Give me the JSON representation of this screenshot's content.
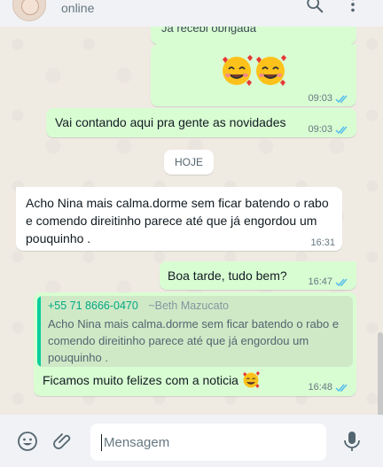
{
  "header": {
    "status": "online"
  },
  "messages": {
    "m1_text": "Já recebi obrigada",
    "m2_time": "09:03",
    "m3_text": "Vai contando aqui pra gente as novidades",
    "m3_time": "09:03",
    "date_divider": "HOJE",
    "m4_line1": "Acho Nina mais calma.dorme sem ficar batendo o rabo",
    "m4_line2": "e comendo direitinho parece até que já engordou um",
    "m4_line3": "pouquinho .",
    "m4_time": "16:31",
    "m5_text": "Boa tarde, tudo bem?",
    "m5_time": "16:47",
    "m6_quote_phone": "+55 71 8666-0470",
    "m6_quote_name": "~Beth Mazucato",
    "m6_quote_line1": "Acho Nina mais calma.dorme sem ficar batendo o rabo e",
    "m6_quote_line2": "comendo direitinho parece até que já engordou um",
    "m6_quote_line3": "pouquinho .",
    "m6_text": "Ficamos muito felizes com a noticia",
    "m6_time": "16:48"
  },
  "composer": {
    "placeholder": "Mensagem"
  },
  "icons": {
    "search": "search-icon",
    "menu": "more-vertical-icon",
    "emoji": "emoji-icon",
    "attach": "paperclip-icon",
    "mic": "microphone-icon",
    "read_ticks": "double-check-icon"
  },
  "colors": {
    "outgoing_bubble": "#d9fdd3",
    "incoming_bubble": "#ffffff",
    "read_ticks": "#53bdeb",
    "quote_accent": "#06cf9c",
    "background": "#efeae2"
  }
}
